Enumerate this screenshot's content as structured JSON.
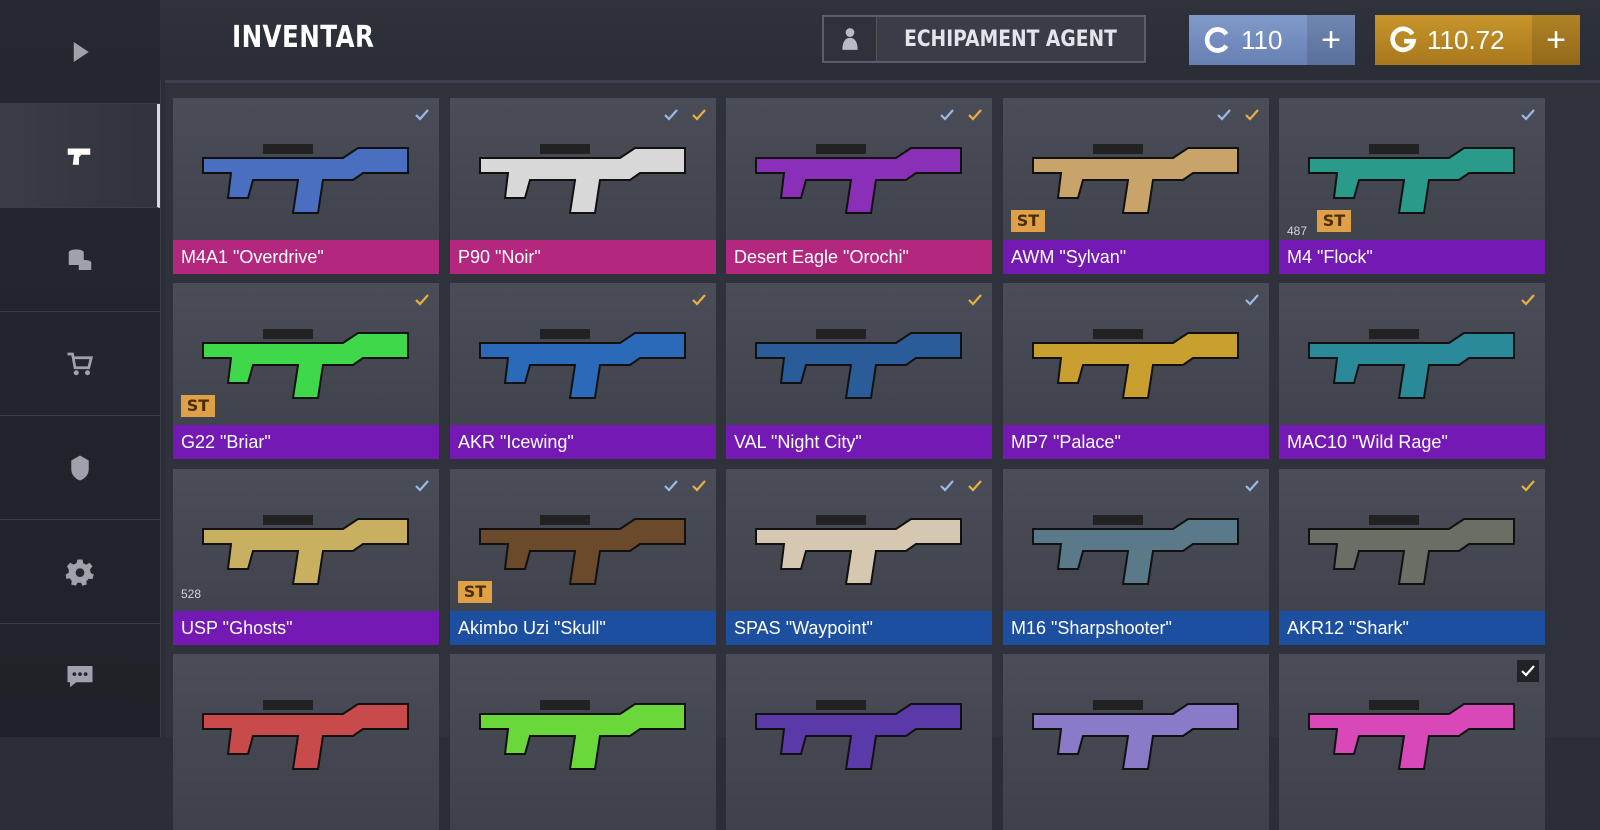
{
  "sidebar": {
    "items": [
      {
        "icon": "play-icon",
        "active": false
      },
      {
        "icon": "pistol-icon",
        "active": true
      },
      {
        "icon": "coins-icon",
        "active": false
      },
      {
        "icon": "cart-icon",
        "active": false
      },
      {
        "icon": "emblem-icon",
        "active": false
      },
      {
        "icon": "gear-icon",
        "active": false
      },
      {
        "icon": "chat-icon",
        "active": false
      }
    ]
  },
  "header": {
    "title": "INVENTAR",
    "agent_button": "ECHIPAMENT AGENT",
    "credits": {
      "value": "110",
      "plus": "+"
    },
    "gold": {
      "value": "110.72",
      "plus": "+"
    }
  },
  "colors": {
    "pink": "#b3287e",
    "purple": "#7519b4",
    "blue": "#1d4fa0",
    "gold": "#c8952a",
    "credit": "#7f9ac9"
  },
  "items": [
    {
      "name": "M4A1 \"Overdrive\"",
      "rarity": "pink",
      "checks": [
        "blue"
      ],
      "st": false
    },
    {
      "name": "P90 \"Noir\"",
      "rarity": "pink",
      "checks": [
        "blue",
        "gold"
      ],
      "st": false
    },
    {
      "name": "Desert Eagle \"Orochi\"",
      "rarity": "pink",
      "checks": [
        "blue",
        "gold"
      ],
      "st": false
    },
    {
      "name": "AWM \"Sylvan\"",
      "rarity": "purple",
      "checks": [
        "blue",
        "gold"
      ],
      "st": true
    },
    {
      "name": "M4 \"Flock\"",
      "rarity": "purple",
      "checks": [
        "blue"
      ],
      "st": true,
      "count": "487"
    },
    {
      "name": "G22 \"Briar\"",
      "rarity": "purple",
      "checks": [
        "gold"
      ],
      "st": true
    },
    {
      "name": "AKR \"Icewing\"",
      "rarity": "purple",
      "checks": [
        "gold"
      ],
      "st": false
    },
    {
      "name": "VAL \"Night City\"",
      "rarity": "purple",
      "checks": [
        "gold"
      ],
      "st": false
    },
    {
      "name": "MP7 \"Palace\"",
      "rarity": "purple",
      "checks": [
        "blue"
      ],
      "st": false
    },
    {
      "name": "MAC10 \"Wild Rage\"",
      "rarity": "purple",
      "checks": [
        "gold"
      ],
      "st": false
    },
    {
      "name": "USP \"Ghosts\"",
      "rarity": "purple",
      "checks": [
        "blue"
      ],
      "st": false,
      "count": "528"
    },
    {
      "name": "Akimbo Uzi \"Skull\"",
      "rarity": "blue",
      "checks": [
        "blue",
        "gold"
      ],
      "st": true
    },
    {
      "name": "SPAS \"Waypoint\"",
      "rarity": "blue",
      "checks": [
        "blue",
        "gold"
      ],
      "st": false
    },
    {
      "name": "M16 \"Sharpshooter\"",
      "rarity": "blue",
      "checks": [
        "blue"
      ],
      "st": false
    },
    {
      "name": "AKR12 \"Shark\"",
      "rarity": "blue",
      "checks": [
        "gold"
      ],
      "st": false
    },
    {
      "name": "",
      "rarity": "none",
      "checks": [],
      "st": false
    },
    {
      "name": "",
      "rarity": "none",
      "checks": [],
      "st": false
    },
    {
      "name": "",
      "rarity": "none",
      "checks": [],
      "st": false
    },
    {
      "name": "",
      "rarity": "none",
      "checks": [],
      "st": false
    },
    {
      "name": "",
      "rarity": "none",
      "checks": [
        "white"
      ],
      "st": false
    }
  ],
  "st_label": "ST"
}
